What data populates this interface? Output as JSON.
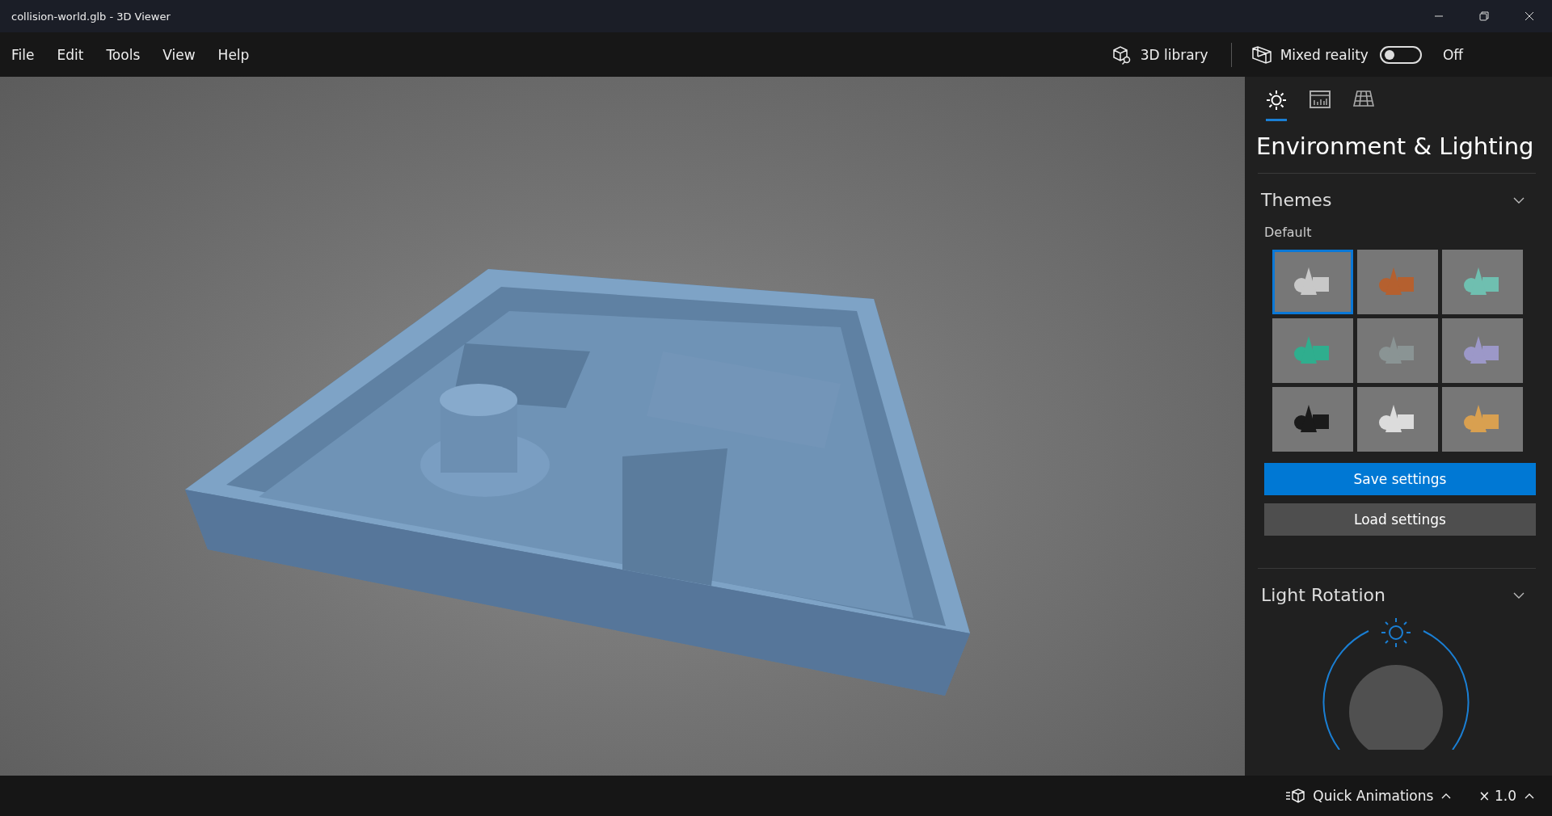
{
  "window": {
    "title": "collision-world.glb - 3D Viewer"
  },
  "menu": [
    "File",
    "Edit",
    "Tools",
    "View",
    "Help"
  ],
  "toolbar": {
    "library": "3D library",
    "mixed_reality": {
      "label": "Mixed reality",
      "on": false,
      "state_text": "Off"
    }
  },
  "panel": {
    "tabs": [
      {
        "kind": "lighting",
        "selected": true
      },
      {
        "kind": "stats",
        "selected": false
      },
      {
        "kind": "grid",
        "selected": false
      }
    ],
    "title": "Environment & Lighting",
    "themes": {
      "heading": "Themes",
      "current": "Default",
      "items": [
        {
          "color": "#c8c8c8",
          "selected": true
        },
        {
          "color": "#b5602f",
          "selected": false
        },
        {
          "color": "#6fbfb0",
          "selected": false
        },
        {
          "color": "#2fae8e",
          "selected": false
        },
        {
          "color": "#8a9494",
          "selected": false
        },
        {
          "color": "#9c98c8",
          "selected": false
        },
        {
          "color": "#1a1a1a",
          "selected": false
        },
        {
          "color": "#dcdcdc",
          "selected": false
        },
        {
          "color": "#d9a050",
          "selected": false
        }
      ]
    },
    "buttons": [
      {
        "kind": "primary",
        "label": "Save settings"
      },
      {
        "kind": "secondary",
        "label": "Load settings"
      }
    ],
    "light_rotation": {
      "heading": "Light Rotation"
    }
  },
  "status_bar": {
    "animations": "Quick Animations",
    "speed": "× 1.0"
  }
}
